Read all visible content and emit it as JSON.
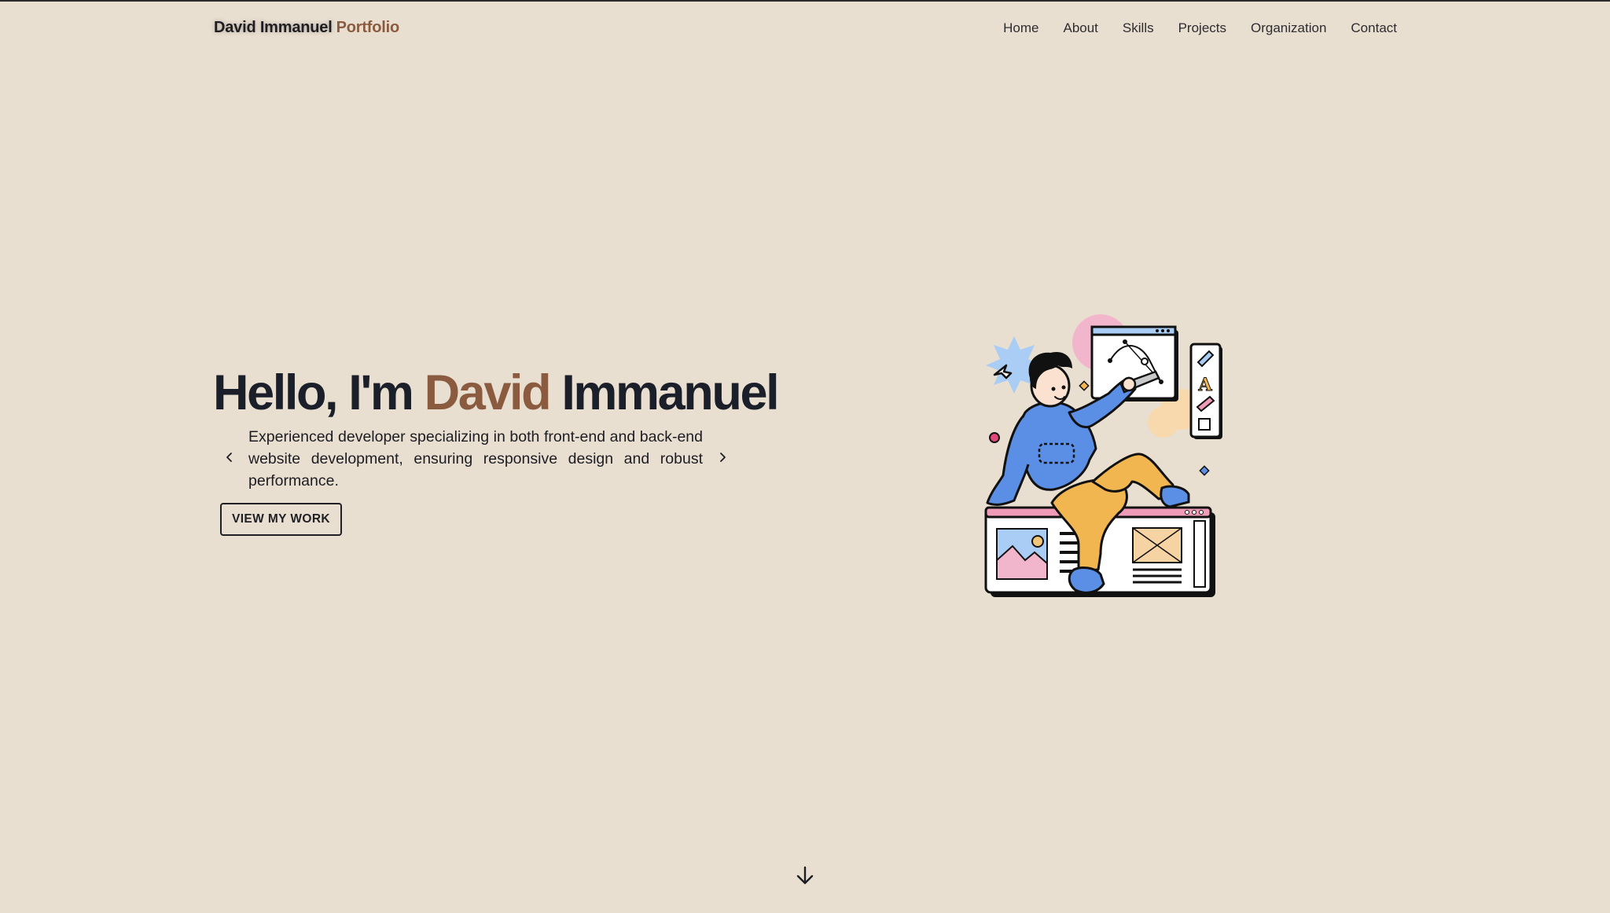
{
  "nav": {
    "brand_name": "David Immanuel",
    "brand_suffix": "Portfolio",
    "links": [
      "Home",
      "About",
      "Skills",
      "Projects",
      "Organization",
      "Contact"
    ]
  },
  "hero": {
    "title_prefix": "Hello, I'm",
    "title_accent": "David",
    "title_suffix": "Immanuel",
    "carousel_text": "Experienced developer specializing in both front-end and back-end website development, ensuring responsive design and robust performance.",
    "cta_label": "VIEW MY WORK",
    "prev_icon": "chevron-left-icon",
    "next_icon": "chevron-right-icon"
  },
  "scroll_icon": "arrow-down-icon",
  "colors": {
    "background": "#e9dfd1",
    "accent": "#8a5b3f",
    "text": "#1b1f29"
  }
}
